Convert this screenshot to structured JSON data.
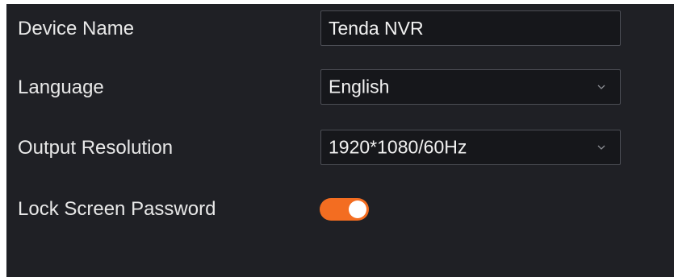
{
  "settings": {
    "device_name": {
      "label": "Device Name",
      "value": "Tenda NVR"
    },
    "language": {
      "label": "Language",
      "selected": "English",
      "icon": "chevron-down-icon"
    },
    "output_resolution": {
      "label": "Output Resolution",
      "selected": "1920*1080/60Hz",
      "icon": "chevron-down-icon"
    },
    "lock_screen_password": {
      "label": "Lock Screen Password",
      "enabled": true
    }
  },
  "colors": {
    "panel_background": "#1f2025",
    "field_background": "#16171b",
    "field_border": "#4b4d54",
    "text": "#e8e8e8",
    "toggle_on": "#f36d21"
  }
}
